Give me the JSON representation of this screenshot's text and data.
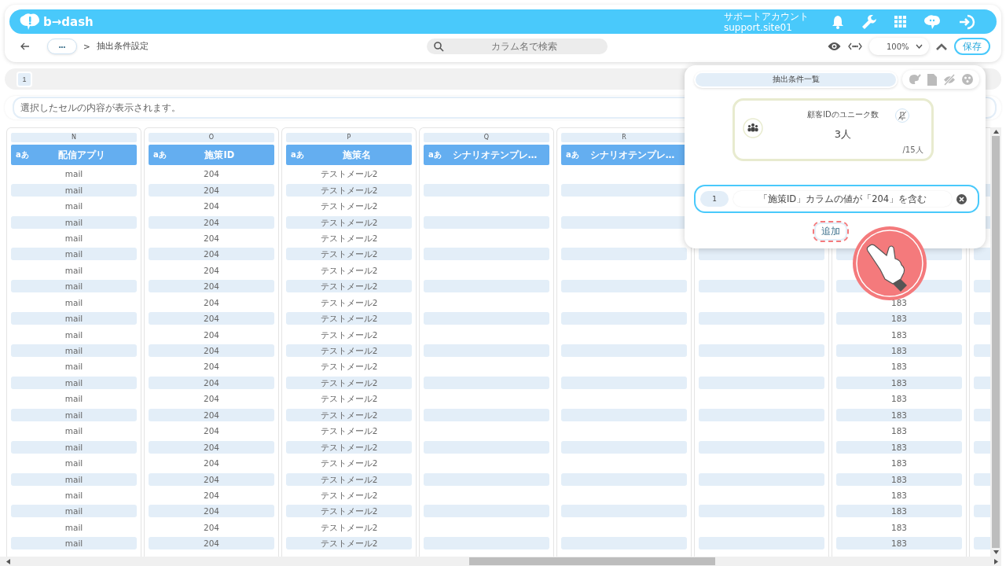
{
  "header": {
    "logo": "b→dash",
    "account_name": "サポートアカウント",
    "account_id": "support.site01"
  },
  "toolbar": {
    "more": "•••",
    "separator": ">",
    "breadcrumb": "抽出条件設定",
    "search": {
      "placeholder": "カラム名で検索"
    },
    "zoom": "100%",
    "save": "保存"
  },
  "sheet_tabs": [
    {
      "label": "1",
      "selected": true
    }
  ],
  "cell_preview": {
    "placeholder": "選択したセルの内容が表示されます。"
  },
  "columns": [
    {
      "letter": "N",
      "type_icon": "aあ",
      "header": "配信アプリ",
      "cells": [
        "mail",
        "mail",
        "mail",
        "mail",
        "mail",
        "mail",
        "mail",
        "mail",
        "mail",
        "mail",
        "mail",
        "mail",
        "mail",
        "mail",
        "mail",
        "mail",
        "mail",
        "mail",
        "mail",
        "mail",
        "mail",
        "mail",
        "mail",
        "mail"
      ]
    },
    {
      "letter": "O",
      "type_icon": "aあ",
      "header": "施策ID",
      "cells": [
        "204",
        "204",
        "204",
        "204",
        "204",
        "204",
        "204",
        "204",
        "204",
        "204",
        "204",
        "204",
        "204",
        "204",
        "204",
        "204",
        "204",
        "204",
        "204",
        "204",
        "204",
        "204",
        "204",
        "204"
      ]
    },
    {
      "letter": "P",
      "type_icon": "aあ",
      "header": "施策名",
      "cells": [
        "テストメール2",
        "テストメール2",
        "テストメール2",
        "テストメール2",
        "テストメール2",
        "テストメール2",
        "テストメール2",
        "テストメール2",
        "テストメール2",
        "テストメール2",
        "テストメール2",
        "テストメール2",
        "テストメール2",
        "テストメール2",
        "テストメール2",
        "テストメール2",
        "テストメール2",
        "テストメール2",
        "テストメール2",
        "テストメール2",
        "テストメール2",
        "テストメール2",
        "テストメール2",
        "テストメール2"
      ]
    },
    {
      "letter": "Q",
      "type_icon": "aあ",
      "header": "シナリオテンプレ…"
    },
    {
      "letter": "R",
      "type_icon": "aあ",
      "header": "シナリオテンプレ…"
    },
    {},
    {
      "cells": [
        "183",
        "183",
        "183",
        "183",
        "183",
        "183",
        "183",
        "183",
        "183",
        "183",
        "183",
        "183",
        "183",
        "183",
        "183",
        "183"
      ]
    },
    {}
  ],
  "panel": {
    "tab": {
      "label": "抽出条件一覧",
      "selected": true
    },
    "metric": {
      "title": "顧客IDのユニーク数",
      "value": "3人",
      "total": "/15人"
    },
    "conditions": [
      {
        "number": "1",
        "text": "「施策ID」カラムの値が「204」を含む"
      }
    ],
    "add_button": "追加"
  }
}
